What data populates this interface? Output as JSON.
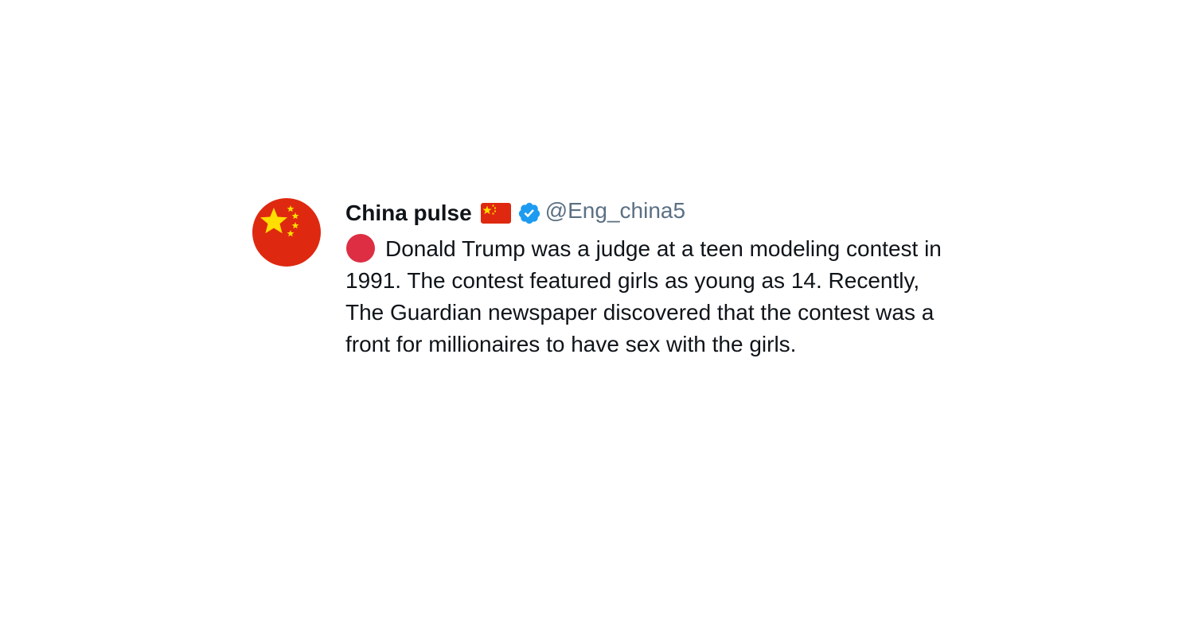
{
  "tweet": {
    "avatar_icon": "china-flag-avatar",
    "display_name": "China pulse",
    "name_emoji": "china-flag-icon",
    "verified_icon": "verified-badge-icon",
    "handle": "@Eng_china5",
    "lead_emoji": "red-circle-icon",
    "text": "Donald Trump was a judge at a teen modeling contest in 1991. The contest featured girls as young as 14. Recently, The Guardian newspaper discovered that the contest was a front for millionaires to have sex with the girls."
  },
  "colors": {
    "flag_red": "#de2910",
    "flag_yellow": "#ffde00",
    "verified_blue": "#1d9bf0",
    "handle_gray": "#5b7083",
    "red_circle": "#dd2e44"
  }
}
